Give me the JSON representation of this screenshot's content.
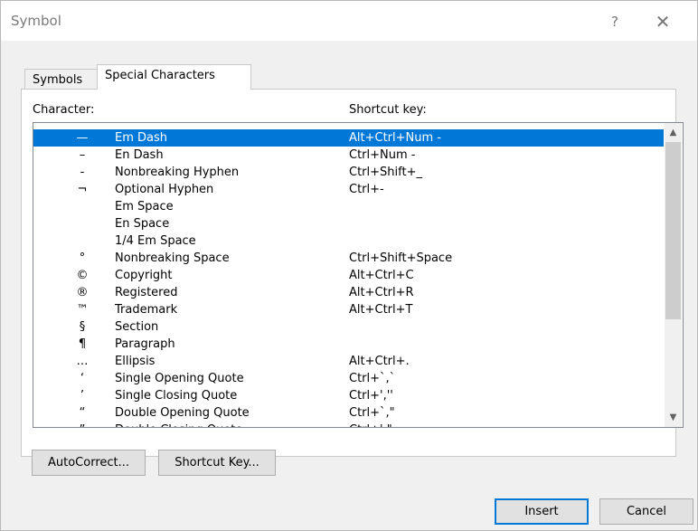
{
  "dialog": {
    "title": "Symbol",
    "help_glyph": "?",
    "close_glyph": "✕"
  },
  "tabs": [
    {
      "label": "Symbols",
      "access_key_index": 0,
      "selected": false
    },
    {
      "label": "Special Characters",
      "access_key_index": 1,
      "selected": true
    }
  ],
  "columns": {
    "character": "Character:",
    "shortcut": "Shortcut key:"
  },
  "rows": [
    {
      "glyph": "—",
      "name": "Em Dash",
      "shortcut": "Alt+Ctrl+Num -",
      "selected": true
    },
    {
      "glyph": "–",
      "name": "En Dash",
      "shortcut": "Ctrl+Num -"
    },
    {
      "glyph": "‑",
      "name": "Nonbreaking Hyphen",
      "shortcut": "Ctrl+Shift+_"
    },
    {
      "glyph": "¬",
      "name": "Optional Hyphen",
      "shortcut": "Ctrl+-"
    },
    {
      "glyph": "",
      "name": "Em Space",
      "shortcut": ""
    },
    {
      "glyph": "",
      "name": "En Space",
      "shortcut": ""
    },
    {
      "glyph": "",
      "name": "1/4 Em Space",
      "shortcut": ""
    },
    {
      "glyph": "°",
      "name": "Nonbreaking Space",
      "shortcut": "Ctrl+Shift+Space"
    },
    {
      "glyph": "©",
      "name": "Copyright",
      "shortcut": "Alt+Ctrl+C"
    },
    {
      "glyph": "®",
      "name": "Registered",
      "shortcut": "Alt+Ctrl+R"
    },
    {
      "glyph": "™",
      "name": "Trademark",
      "shortcut": "Alt+Ctrl+T"
    },
    {
      "glyph": "§",
      "name": "Section",
      "shortcut": ""
    },
    {
      "glyph": "¶",
      "name": "Paragraph",
      "shortcut": ""
    },
    {
      "glyph": "…",
      "name": "Ellipsis",
      "shortcut": "Alt+Ctrl+."
    },
    {
      "glyph": "‘",
      "name": "Single Opening Quote",
      "shortcut": "Ctrl+`,`"
    },
    {
      "glyph": "’",
      "name": "Single Closing Quote",
      "shortcut": "Ctrl+',''"
    },
    {
      "glyph": "“",
      "name": "Double Opening Quote",
      "shortcut": "Ctrl+`,\""
    },
    {
      "glyph": "”",
      "name": "Double Closing Quote",
      "shortcut": "Ctrl+',\""
    }
  ],
  "scrollbar": {
    "up_glyph": "▲",
    "down_glyph": "▼"
  },
  "buttons": {
    "autocorrect": "AutoCorrect...",
    "shortcut_key": "Shortcut Key...",
    "insert": "Insert",
    "cancel": "Cancel"
  },
  "colors": {
    "selection": "#0078d7",
    "window_bg": "#f0f0f0"
  }
}
